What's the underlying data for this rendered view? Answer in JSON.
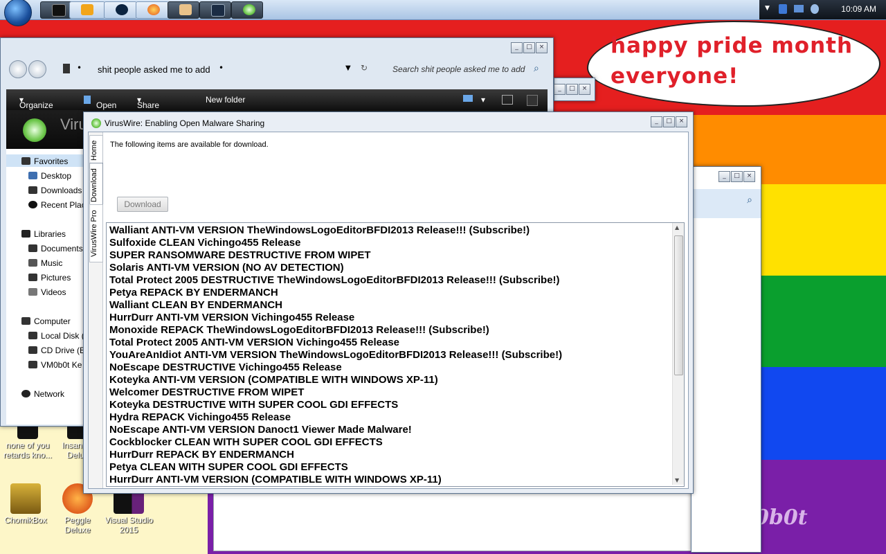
{
  "colors": {
    "red": "#e51f1f",
    "orange": "#ff8c00",
    "yellow": "#ffe100",
    "green": "#0a9f2e",
    "blue": "#1148f0",
    "purple": "#7a1fa8",
    "bubble_text": "#e0202a"
  },
  "wallpaper": {
    "bubble_text_1": "happy pride month",
    "bubble_text_2": "everyone!",
    "watermark": "0b0t"
  },
  "desktop_icons": [
    {
      "label_1": "none of you",
      "label_2": "retards kno..."
    },
    {
      "label_1": "Insaniqu",
      "label_2": "Delux"
    },
    {
      "label_1": "ChomikBox",
      "label_2": ""
    },
    {
      "label_1": "Peggle",
      "label_2": "Deluxe"
    },
    {
      "label_1": "Visual Studio",
      "label_2": "2015"
    }
  ],
  "taskbar": {
    "clock": "10:09 AM",
    "icons": [
      "terminal-icon",
      "media-player-icon",
      "sphere-icon",
      "firefox-icon",
      "user-icon",
      "monitor-icon",
      "virus-wire-icon"
    ]
  },
  "explorer": {
    "breadcrumb": "shit people asked me to add",
    "search_placeholder": "Search shit people asked me to add",
    "toolbar": {
      "organize": "Organize",
      "open": "Open",
      "share": "Share with",
      "new_folder": "New folder"
    },
    "banner_title": "Viru",
    "nav": {
      "favorites": "Favorites",
      "desktop": "Desktop",
      "downloads": "Downloads",
      "recent": "Recent Plac",
      "libraries": "Libraries",
      "documents": "Documents",
      "music": "Music",
      "pictures": "Pictures",
      "videos": "Videos",
      "computer": "Computer",
      "local_disk": "Local Disk (",
      "cd_drive": "CD Drive (E",
      "vm": "VM0b0t Ke",
      "network": "Network"
    }
  },
  "viruswire": {
    "title": "VirusWire: Enabling Open Malware Sharing",
    "tabs": {
      "home": "Home",
      "download": "Download",
      "pro": "VirusWire Pro"
    },
    "intro": "The following items are available for download.",
    "download_button": "Download",
    "items": [
      "Walliant ANTI-VM VERSION TheWindowsLogoEditorBFDI2013 Release!!! (Subscribe!)",
      "Sulfoxide CLEAN Vichingo455 Release",
      "SUPER RANSOMWARE DESTRUCTIVE FROM WIPET",
      "Solaris ANTI-VM VERSION (NO AV DETECTION)",
      "Total Protect 2005 DESTRUCTIVE TheWindowsLogoEditorBFDI2013 Release!!! (Subscribe!)",
      "Petya REPACK BY ENDERMANCH",
      "Walliant CLEAN BY ENDERMANCH",
      "HurrDurr ANTI-VM VERSION Vichingo455 Release",
      "Monoxide REPACK TheWindowsLogoEditorBFDI2013 Release!!! (Subscribe!)",
      "Total Protect 2005 ANTI-VM VERSION Vichingo455 Release",
      "YouAreAnIdiot ANTI-VM VERSION TheWindowsLogoEditorBFDI2013 Release!!! (Subscribe!)",
      "NoEscape DESTRUCTIVE Vichingo455 Release",
      "Koteyka ANTI-VM VERSION (COMPATIBLE WITH WINDOWS XP-11)",
      "Welcomer DESTRUCTIVE FROM WIPET",
      "Koteyka DESTRUCTIVE WITH SUPER COOL GDI EFFECTS",
      "Hydra REPACK Vichingo455 Release",
      "NoEscape ANTI-VM VERSION Danoct1 Viewer Made Malware!",
      "Cockblocker CLEAN WITH SUPER COOL GDI EFFECTS",
      "HurrDurr REPACK BY ENDERMANCH",
      "Petya CLEAN WITH SUPER COOL GDI EFFECTS",
      "HurrDurr ANTI-VM VERSION (COMPATIBLE WITH WINDOWS XP-11)"
    ]
  }
}
